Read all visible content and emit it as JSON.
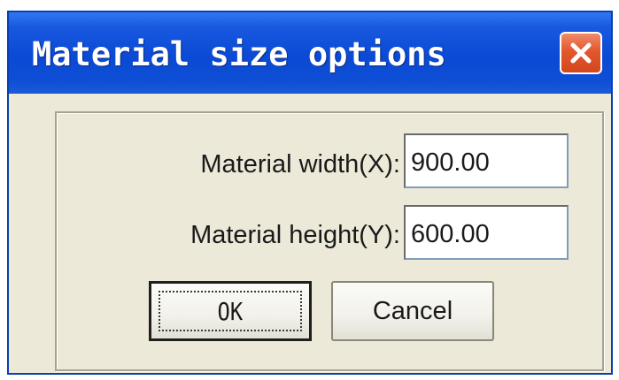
{
  "window": {
    "title": "Material size options",
    "close_icon": "close-icon"
  },
  "form": {
    "width_label": "Material width(X):",
    "width_value": "900.00",
    "height_label": "Material height(Y):",
    "height_value": "600.00"
  },
  "buttons": {
    "ok_label": "OK",
    "cancel_label": "Cancel"
  },
  "colors": {
    "titlebar": "#0a4ad4",
    "close": "#d4461e",
    "dialog_bg": "#ece9d8"
  }
}
